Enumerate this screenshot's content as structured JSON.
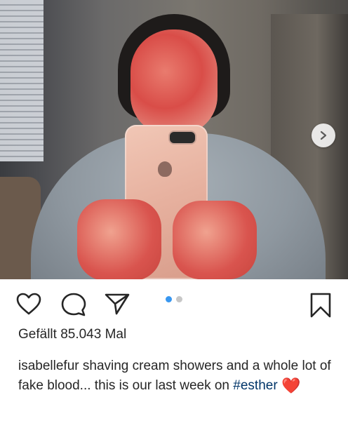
{
  "post": {
    "image_description_icon": "photo",
    "carousel_next_icon": "chevron-right-icon",
    "carousel": {
      "total": 2,
      "active_index": 0
    },
    "actions": {
      "like_icon": "heart-outline-icon",
      "comment_icon": "comment-icon",
      "share_icon": "send-icon",
      "save_icon": "bookmark-icon"
    },
    "likes_text": "Gefällt 85.043 Mal",
    "caption": {
      "username": "isabellefur",
      "text": " shaving cream showers and a whole lot of fake blood... this is our last week on ",
      "hashtag": "#esther",
      "emoji": "❤️"
    }
  },
  "colors": {
    "accent_blue": "#3897f0",
    "text": "#262626",
    "hashtag": "#003569",
    "heart_red": "#e0322e"
  }
}
